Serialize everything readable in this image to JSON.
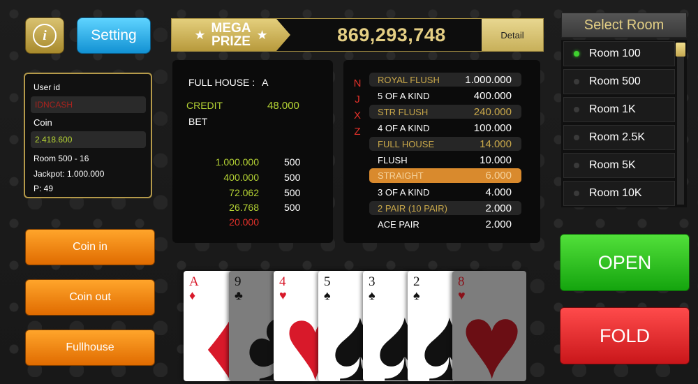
{
  "header": {
    "info_label": "i",
    "setting_label": "Setting",
    "mega_line1": "MEGA",
    "mega_line2": "PRIZE",
    "mega_amount": "869,293,748",
    "detail_label": "Detail"
  },
  "user": {
    "user_id_label": "User id",
    "user_id_value": "IDNCASH",
    "coin_label": "Coin",
    "coin_value": "2.418.600",
    "room_line": "Room 500 - 16",
    "jackpot_line": "Jackpot: 1.000.000",
    "p_line": "P: 49"
  },
  "left_buttons": {
    "coin_in": "Coin in",
    "coin_out": "Coin out",
    "fullhouse": "Fullhouse"
  },
  "bet_panel": {
    "full_house_label": "FULL HOUSE :",
    "full_house_value": "A",
    "credit_label": "CREDIT",
    "credit_value": "48.000",
    "bet_label": "BET",
    "rows": [
      {
        "amount": "1.000.000",
        "bet": "500"
      },
      {
        "amount": "400.000",
        "bet": "500"
      },
      {
        "amount": "72.062",
        "bet": "500"
      },
      {
        "amount": "26.768",
        "bet": "500"
      },
      {
        "amount": "20.000",
        "bet": ""
      }
    ]
  },
  "paytable": {
    "side_letters": [
      "N",
      "J",
      "X",
      "Z"
    ],
    "rows": [
      {
        "hand": "ROYAL FLUSH",
        "value": "1.000.000"
      },
      {
        "hand": "5 OF A KIND",
        "value": "400.000"
      },
      {
        "hand": "STR FLUSH",
        "value": "240.000"
      },
      {
        "hand": "4 OF A KIND",
        "value": "100.000"
      },
      {
        "hand": "FULL HOUSE",
        "value": "14.000"
      },
      {
        "hand": "FLUSH",
        "value": "10.000"
      },
      {
        "hand": "STRAIGHT",
        "value": "6.000"
      },
      {
        "hand": "3 OF A KIND",
        "value": "4.000"
      },
      {
        "hand": "2 PAIR (10 PAIR)",
        "value": "2.000"
      },
      {
        "hand": "ACE PAIR",
        "value": "2.000"
      }
    ]
  },
  "rooms": {
    "title": "Select Room",
    "items": [
      "Room 100",
      "Room 500",
      "Room 1K",
      "Room 2.5K",
      "Room 5K",
      "Room 10K"
    ],
    "selected": "Room 100"
  },
  "actions": {
    "open": "OPEN",
    "fold": "FOLD"
  },
  "cards": [
    {
      "rank": "A",
      "suit": "♦"
    },
    {
      "rank": "9",
      "suit": "♣"
    },
    {
      "rank": "4",
      "suit": "♥"
    },
    {
      "rank": "5",
      "suit": "♠"
    },
    {
      "rank": "3",
      "suit": "♠"
    },
    {
      "rank": "2",
      "suit": "♠"
    },
    {
      "rank": "8",
      "suit": "♥"
    }
  ],
  "colors": {
    "gold": "#c9a84a",
    "credit_green": "#b5d334",
    "highlight_orange": "#d98a2d",
    "red_value": "#e3312a"
  }
}
